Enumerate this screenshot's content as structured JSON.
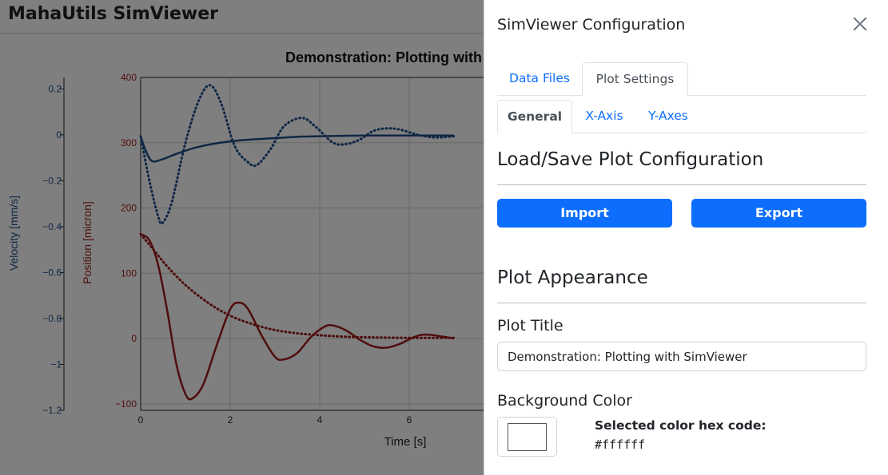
{
  "app": {
    "title": "MahaUtils SimViewer"
  },
  "plot": {
    "title": "Demonstration: Plotting with SimViewer",
    "colors": {
      "velocity": "#1f4e8c",
      "position": "#9e1b1b",
      "grid": "#d0d0d0"
    }
  },
  "chart_data": {
    "type": "line",
    "title": "Demonstration: Plotting with SimViewer",
    "xlabel": "Time [s]",
    "xlim": [
      0,
      10
    ],
    "xticks": [
      "0",
      "2",
      "4",
      "6"
    ],
    "y_axes": [
      {
        "label": "Velocity [mm/s]",
        "ylim": [
          -1.2,
          0.25
        ],
        "ticks": [
          "0.2",
          "0",
          "−0.2",
          "−0.4",
          "−0.6",
          "−0.8",
          "−1",
          "−1.2"
        ],
        "tick_values": [
          0.2,
          0,
          -0.2,
          -0.4,
          -0.6,
          -0.8,
          -1,
          -1.2
        ],
        "color": "#1f4e8c"
      },
      {
        "label": "Position [micron]",
        "ylim": [
          -110,
          400
        ],
        "ticks": [
          "400",
          "300",
          "200",
          "100",
          "0",
          "−100"
        ],
        "tick_values": [
          400,
          300,
          200,
          100,
          0,
          -100
        ],
        "color": "#9e1b1b"
      }
    ],
    "series": [
      {
        "axis": 1,
        "style": "dotted",
        "color": "#1f4e8c",
        "x": [
          0,
          0.2,
          0.4,
          0.5,
          0.7,
          1.0,
          1.3,
          1.55,
          1.8,
          2.1,
          2.4,
          2.6,
          2.9,
          3.2,
          3.6,
          3.9,
          4.3,
          4.6,
          4.9,
          5.2,
          5.5,
          5.8,
          6.2,
          6.6,
          7
        ],
        "y": [
          310,
          240,
          185,
          178,
          210,
          300,
          365,
          388,
          360,
          295,
          270,
          266,
          290,
          325,
          338,
          325,
          300,
          298,
          305,
          318,
          322,
          320,
          312,
          308,
          310
        ]
      },
      {
        "axis": 1,
        "style": "solid",
        "color": "#1f4e8c",
        "x": [
          0,
          0.1,
          0.25,
          0.5,
          0.8,
          1.2,
          1.6,
          2.0,
          2.5,
          3.0,
          3.5,
          4.0,
          5.0,
          6.0,
          7
        ],
        "y": [
          310,
          290,
          272,
          275,
          283,
          292,
          298,
          302,
          305,
          307,
          309,
          310,
          311,
          311,
          311
        ]
      },
      {
        "axis": 1,
        "style": "dotted",
        "color": "#9e1b1b",
        "x": [
          0,
          0.3,
          0.6,
          1.0,
          1.5,
          2.0,
          2.5,
          3.0,
          3.5,
          4.0,
          4.5,
          5.0,
          6.0,
          7
        ],
        "y": [
          160,
          135,
          110,
          82,
          55,
          35,
          22,
          13,
          8,
          5,
          3,
          2,
          1,
          1
        ]
      },
      {
        "axis": 1,
        "style": "solid",
        "color": "#9e1b1b",
        "x": [
          0,
          0.2,
          0.4,
          0.6,
          0.8,
          1.0,
          1.15,
          1.4,
          1.7,
          2.0,
          2.2,
          2.4,
          2.7,
          3.0,
          3.2,
          3.5,
          3.8,
          4.1,
          4.3,
          4.6,
          4.9,
          5.2,
          5.5,
          5.8,
          6.1,
          6.4,
          7
        ],
        "y": [
          160,
          150,
          110,
          40,
          -40,
          -85,
          -92,
          -70,
          -10,
          45,
          55,
          45,
          5,
          -28,
          -32,
          -22,
          2,
          18,
          20,
          12,
          -2,
          -12,
          -14,
          -8,
          2,
          6,
          0
        ]
      }
    ]
  },
  "panel": {
    "title": "SimViewer Configuration",
    "tabs": [
      {
        "label": "Data Files"
      },
      {
        "label": "Plot Settings"
      }
    ],
    "subtabs": [
      {
        "label": "General"
      },
      {
        "label": "X-Axis"
      },
      {
        "label": "Y-Axes"
      }
    ],
    "load_save": {
      "heading": "Load/Save Plot Configuration",
      "import_label": "Import",
      "export_label": "Export"
    },
    "appearance": {
      "heading": "Plot Appearance",
      "plot_title_label": "Plot Title",
      "plot_title_value": "Demonstration: Plotting with SimViewer",
      "bg_color_label": "Background Color",
      "hex_label": "Selected color hex code:",
      "hex_value": "#ffffff",
      "bg_color": "#ffffff"
    }
  }
}
